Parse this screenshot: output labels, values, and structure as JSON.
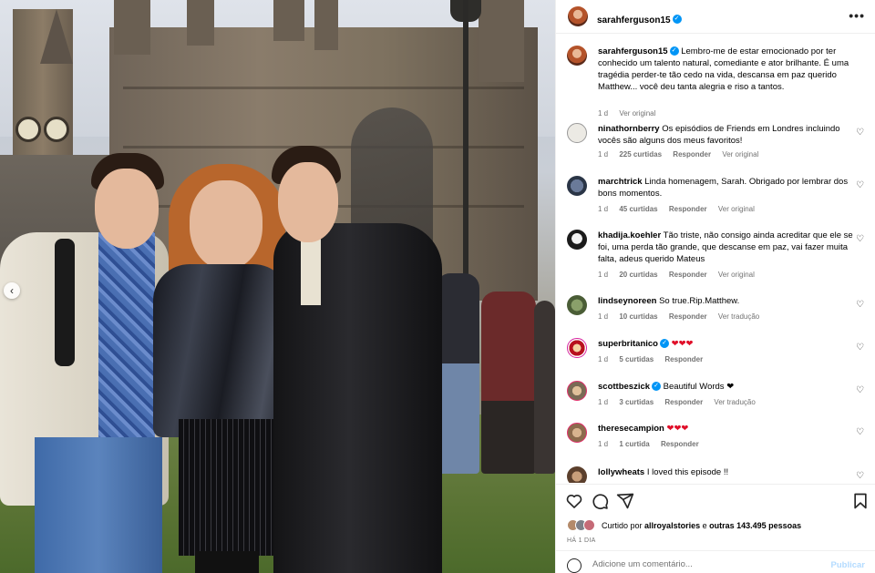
{
  "post": {
    "author": "sarahferguson15",
    "caption": "Lembro-me de estar emocionado por ter conhecido um talento natural, comediante e ator brilhante. É uma tragédia perder-te tão cedo na vida, descansa em paz querido Matthew... você deu tanta alegria e riso a tantos.",
    "caption_time": "1 d",
    "caption_see_original": "Ver original"
  },
  "comments": [
    {
      "user": "ninathornberry",
      "text": "Os episódios de Friends em Londres incluindo vocês são alguns dos meus favoritos!",
      "time": "1 d",
      "likes": "225 curtidas",
      "reply": "Responder",
      "extra": "Ver original"
    },
    {
      "user": "marchtrick",
      "text": "Linda homenagem, Sarah. Obrigado por lembrar dos bons momentos.",
      "time": "1 d",
      "likes": "45 curtidas",
      "reply": "Responder",
      "extra": "Ver original"
    },
    {
      "user": "khadija.koehler",
      "text": "Tão triste, não consigo ainda acreditar que ele se foi, uma perda tão grande, que descanse em paz, vai fazer muita falta, adeus querido Mateus",
      "time": "1 d",
      "likes": "20 curtidas",
      "reply": "Responder",
      "extra": "Ver original"
    },
    {
      "user": "lindseynoreen",
      "text": "So true.Rip.Matthew.",
      "time": "1 d",
      "likes": "10 curtidas",
      "reply": "Responder",
      "extra": "Ver tradução"
    },
    {
      "user": "superbritanico",
      "text": "❤❤❤",
      "time": "1 d",
      "likes": "5 curtidas",
      "reply": "Responder",
      "extra": ""
    },
    {
      "user": "scottbeszick",
      "text": "Beautiful Words ❤",
      "time": "1 d",
      "likes": "3 curtidas",
      "reply": "Responder",
      "extra": "Ver tradução"
    },
    {
      "user": "theresecampion",
      "text": "❤❤❤",
      "time": "1 d",
      "likes": "1 curtida",
      "reply": "Responder",
      "extra": ""
    },
    {
      "user": "lollywheats",
      "text": "I loved this episode !!",
      "time": "",
      "likes": "",
      "reply": "",
      "extra": ""
    }
  ],
  "likes": {
    "prefix": "Curtido por",
    "user": "allroyalstories",
    "middle": "e",
    "others": "outras 143.495 pessoas"
  },
  "time_ago": "HÁ 1 DIA",
  "add_comment": {
    "placeholder": "Adicione um comentário...",
    "publish": "Publicar"
  },
  "icons": {
    "more": "more-options-icon",
    "like": "heart-icon",
    "comment": "comment-icon",
    "share": "share-icon",
    "save": "bookmark-icon",
    "emoji": "emoji-icon",
    "carousel": "chevron-left-icon"
  },
  "colors": {
    "verified": "#0095f6",
    "meta_gray": "#737373",
    "heart_red": "#e0102a",
    "publish_disabled": "#b3dbff"
  }
}
